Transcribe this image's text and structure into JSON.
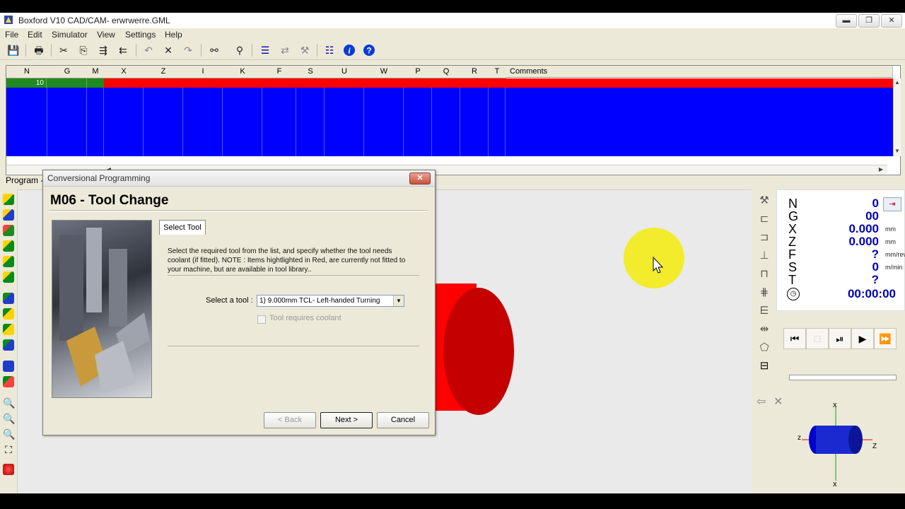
{
  "window": {
    "title": "Boxford V10 CAD/CAM- erwrwerre.GML",
    "controls": {
      "minimize": "▬",
      "maximize": "❐",
      "close": "✕"
    }
  },
  "menu": [
    "File",
    "Edit",
    "Simulator",
    "View",
    "Settings",
    "Help"
  ],
  "toolbar": {
    "icons": [
      "save-icon",
      "print-icon",
      "cut-icon",
      "copy-icon",
      "indent-icon",
      "outdent-icon",
      "undo-icon",
      "delete-icon",
      "redo-icon",
      "find-icon",
      "find-replace-icon",
      "list-icon",
      "transform-icon",
      "tools-icon",
      "view-list-icon",
      "info-icon",
      "help-icon"
    ]
  },
  "grid": {
    "columns": [
      "N",
      "G",
      "M",
      "X",
      "Z",
      "I",
      "K",
      "F",
      "S",
      "U",
      "W",
      "P",
      "Q",
      "R",
      "T",
      "Comments"
    ],
    "rows": [
      {
        "N": "10"
      }
    ],
    "colors": {
      "green": "#1f8a1f",
      "red": "#ff0000",
      "blue": "#0000ff"
    }
  },
  "program_tab_label": "Program -",
  "dialog": {
    "title": "Conversional Programming",
    "close": "✕",
    "heading": "M06 - Tool Change",
    "tab": "Select Tool",
    "description": "Select the required tool from the list, and specify whether the tool needs coolant (if fitted). NOTE : Items hightlighted in Red, are currently not fitted to your machine, but are available in tool library..",
    "select_label": "Select a tool :",
    "select_value": "1) 9.000mm TCL- Left-handed Turning",
    "coolant_label": "Tool requires coolant",
    "buttons": {
      "back": "< Back",
      "next": "Next >",
      "cancel": "Cancel"
    }
  },
  "dro": {
    "N": "0",
    "G": "00",
    "X": "0.000",
    "Z": "0.000",
    "F": "?",
    "S": "0",
    "T": "?",
    "time": "00:00:00",
    "units": {
      "X": "mm",
      "Z": "mm",
      "F": "mm/rev",
      "S": "m/min"
    }
  },
  "axis_labels": {
    "z_left": "z",
    "z_right": "Z",
    "x_top": "x",
    "x_bottom": "x"
  },
  "colors": {
    "accent_blue": "#0000b0",
    "stock_red": "#ff0000",
    "highlight_yellow": "#f2ec1c"
  }
}
